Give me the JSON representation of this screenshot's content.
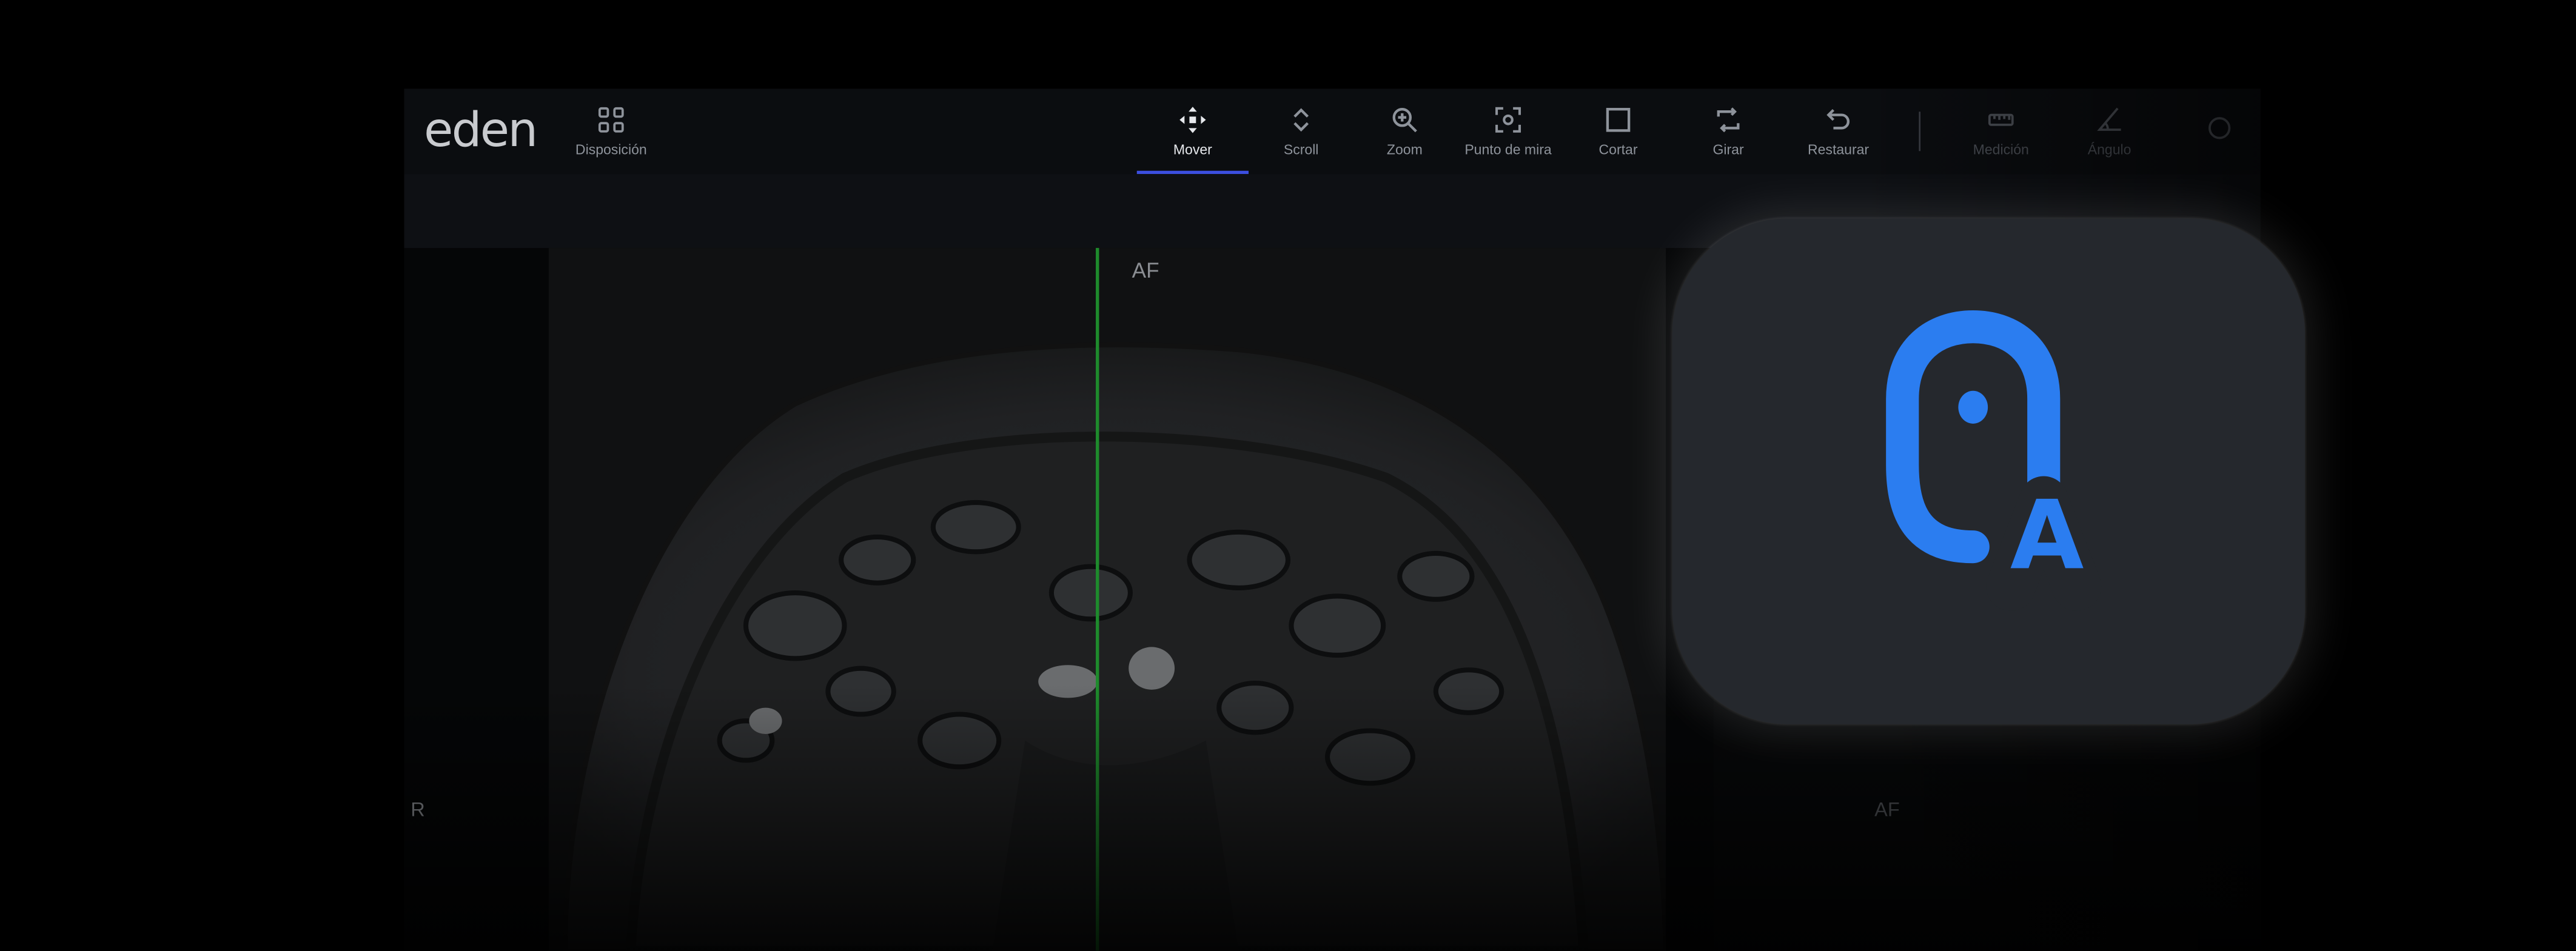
{
  "app": {
    "logo": "eden"
  },
  "toolbar": {
    "layout_label": "Disposición",
    "tools": [
      {
        "label": "Mover",
        "icon": "move-icon",
        "active": true
      },
      {
        "label": "Scroll",
        "icon": "scroll-icon"
      },
      {
        "label": "Zoom",
        "icon": "zoom-icon"
      },
      {
        "label": "Punto de mira",
        "icon": "crosshair-icon"
      },
      {
        "label": "Cortar",
        "icon": "crop-icon"
      },
      {
        "label": "Girar",
        "icon": "rotate-icon"
      },
      {
        "label": "Restaurar",
        "icon": "undo-icon"
      },
      {
        "label": "Medición",
        "icon": "ruler-icon"
      },
      {
        "label": "Ángulo",
        "icon": "angle-icon"
      }
    ]
  },
  "viewer": {
    "orientation_top": "AF",
    "orientation_left": "R",
    "secondary_orientation": "AF"
  },
  "badge": {
    "letter": "A",
    "accent": "#2b7df0"
  },
  "colors": {
    "crosshair": "#1e8a2c",
    "active_tab": "#3c4fe0"
  }
}
